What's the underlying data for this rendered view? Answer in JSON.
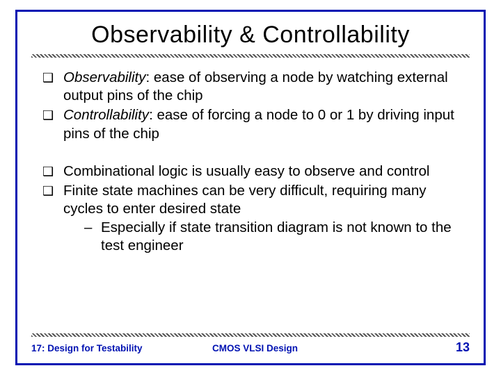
{
  "title": "Observability & Controllability",
  "bullets_a": [
    {
      "term": "Observability",
      "rest": ": ease of observing a node by watching external output pins of the chip"
    },
    {
      "term": "Controllability",
      "rest": ": ease of forcing a node to 0 or 1 by driving input pins of the chip"
    }
  ],
  "bullets_b": [
    {
      "text": "Combinational logic is usually easy to observe and control",
      "sub": []
    },
    {
      "text": "Finite state machines can be very difficult, requiring many cycles to enter desired state",
      "sub": [
        "Especially if state transition diagram is not known to the test engineer"
      ]
    }
  ],
  "footer": {
    "left": "17: Design for Testability",
    "center": "CMOS VLSI Design",
    "page": "13"
  }
}
